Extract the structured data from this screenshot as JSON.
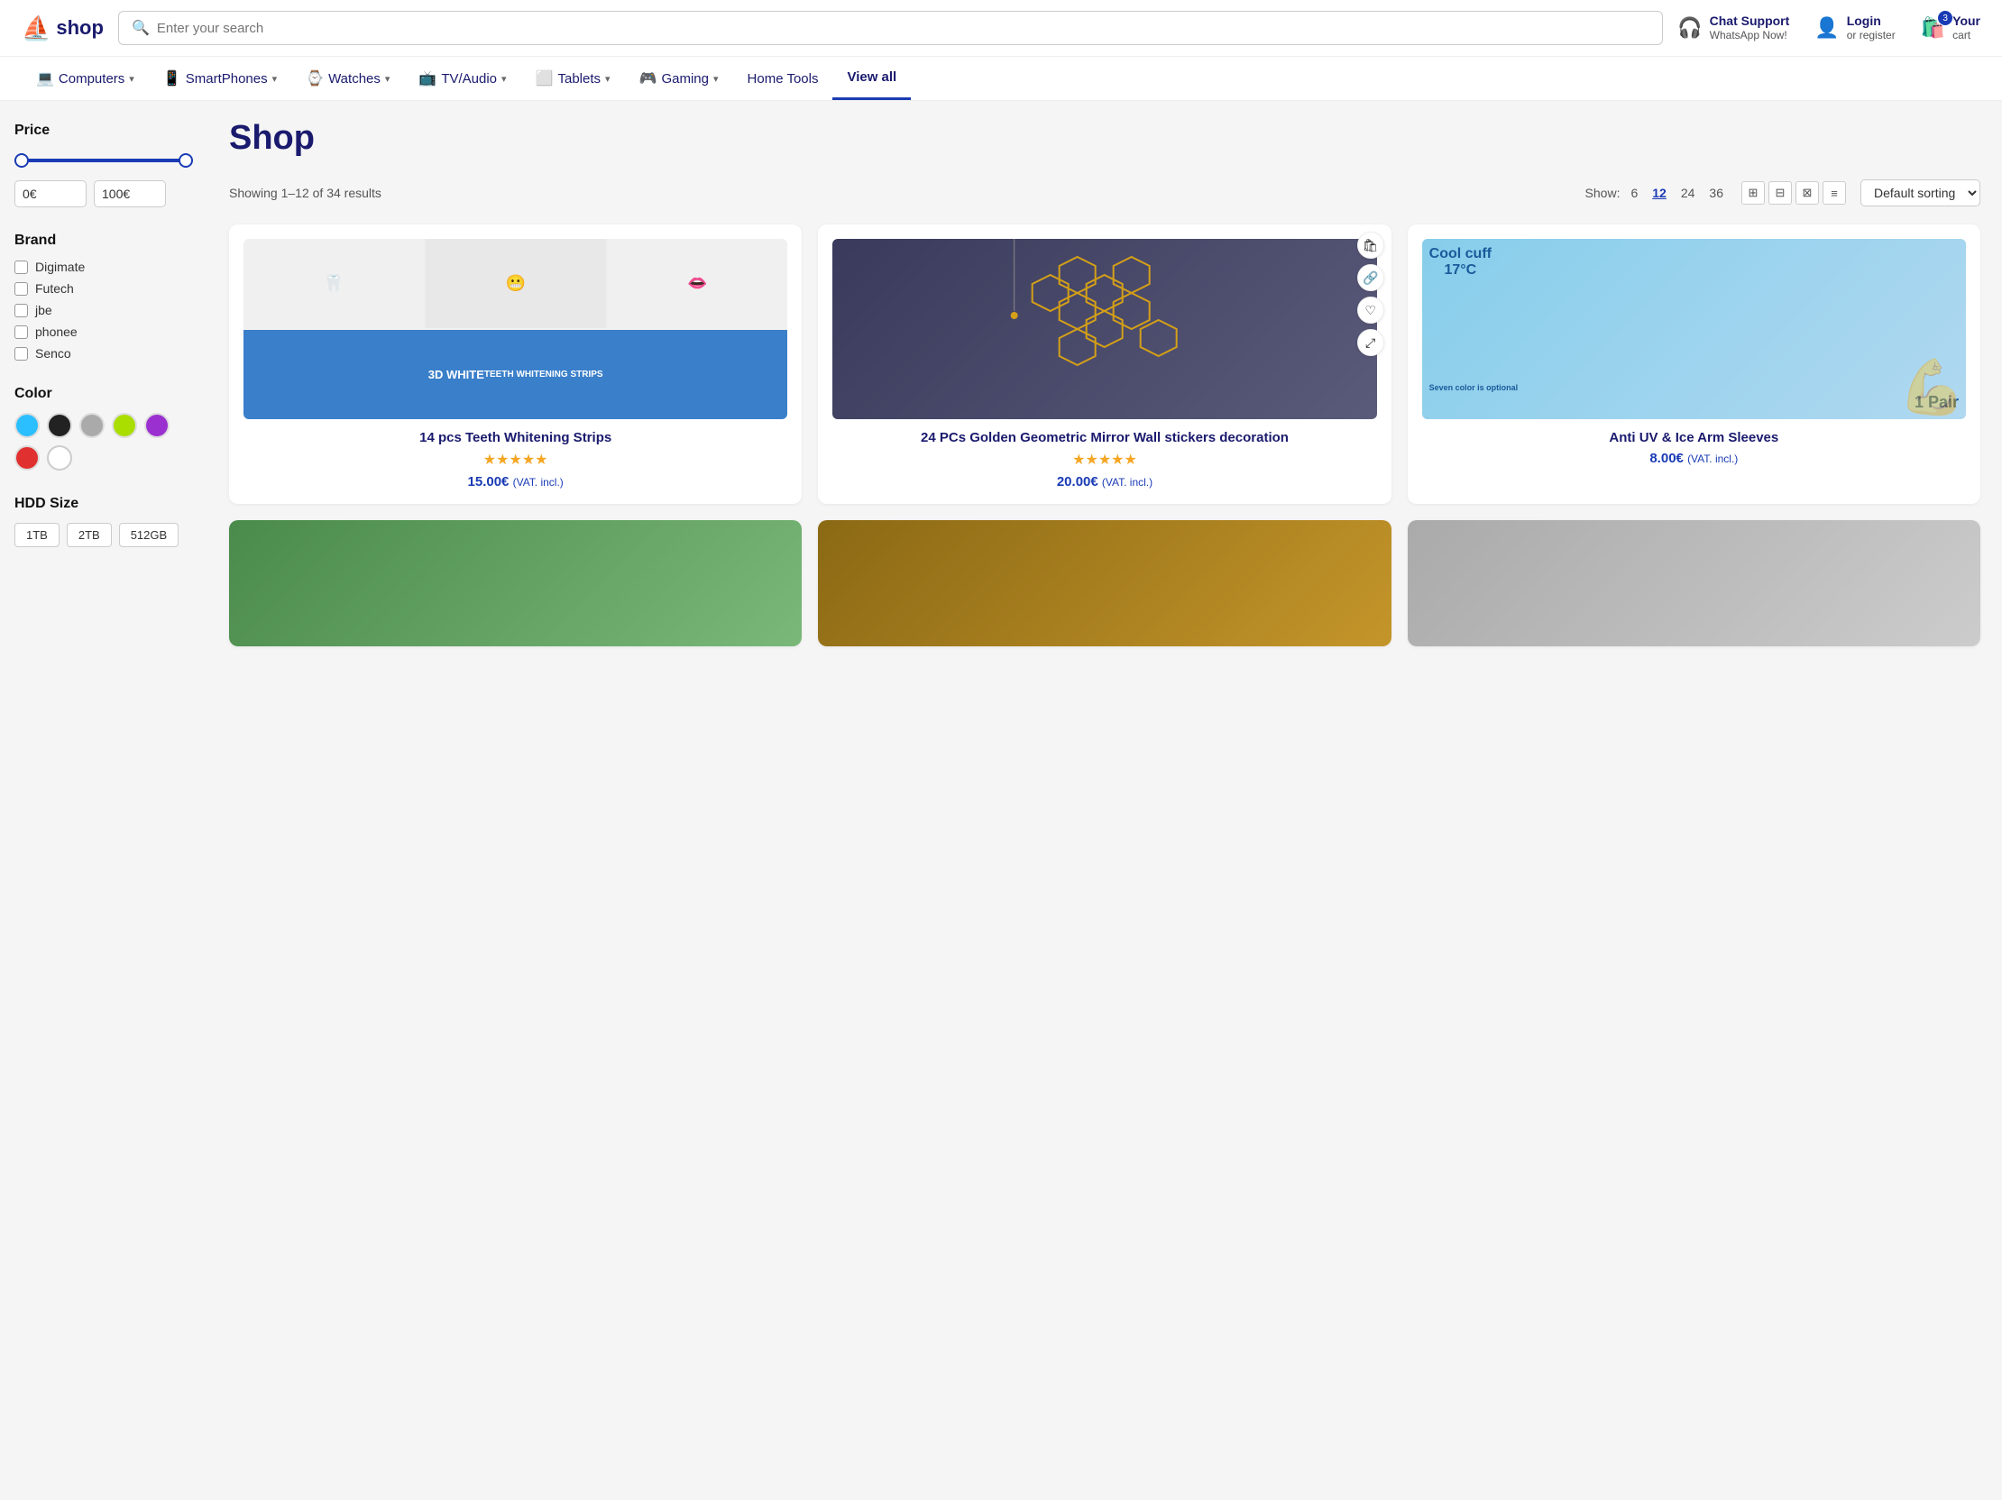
{
  "header": {
    "logo_text": "shop",
    "search_placeholder": "Enter your search",
    "chat_support_top": "Chat Support",
    "chat_support_bot": "WhatsApp Now!",
    "login_top": "Login",
    "login_bot": "or register",
    "cart_top": "Your",
    "cart_bot": "cart",
    "cart_count": "3"
  },
  "nav": {
    "items": [
      {
        "label": "Computers",
        "icon": "💻",
        "has_dropdown": true
      },
      {
        "label": "SmartPhones",
        "icon": "📱",
        "has_dropdown": true
      },
      {
        "label": "Watches",
        "icon": "⌚",
        "has_dropdown": true
      },
      {
        "label": "TV/Audio",
        "icon": "📺",
        "has_dropdown": true
      },
      {
        "label": "Tablets",
        "icon": "⬜",
        "has_dropdown": true
      },
      {
        "label": "Gaming",
        "icon": "🎮",
        "has_dropdown": true
      },
      {
        "label": "Home Tools",
        "icon": "",
        "has_dropdown": false
      },
      {
        "label": "View all",
        "icon": "",
        "has_dropdown": false,
        "active": true
      }
    ]
  },
  "sidebar": {
    "price_label": "Price",
    "price_min": "0€",
    "price_max": "100€",
    "brand_label": "Brand",
    "brands": [
      {
        "name": "Digimate"
      },
      {
        "name": "Futech"
      },
      {
        "name": "jbe"
      },
      {
        "name": "phonee"
      },
      {
        "name": "Senco"
      }
    ],
    "color_label": "Color",
    "colors": [
      {
        "hex": "#2bbfff",
        "name": "light-blue"
      },
      {
        "hex": "#222222",
        "name": "black"
      },
      {
        "hex": "#aaaaaa",
        "name": "gray"
      },
      {
        "hex": "#aadd00",
        "name": "lime"
      },
      {
        "hex": "#9b30d0",
        "name": "purple"
      },
      {
        "hex": "#e03030",
        "name": "red"
      },
      {
        "hex": "#ffffff",
        "name": "white"
      }
    ],
    "hdd_label": "HDD Size",
    "hdd_sizes": [
      "1TB",
      "2TB",
      "512GB"
    ]
  },
  "main": {
    "page_title": "Shop",
    "results_info": "Showing 1–12 of 34 results",
    "show_label": "Show:",
    "show_options": [
      "6",
      "12",
      "24",
      "36"
    ],
    "show_active": "12",
    "sorting_label": "Default sorting",
    "products": [
      {
        "id": 1,
        "name": "14 pcs Teeth Whitening Strips",
        "rating": 5,
        "price": "15.00€",
        "vat": "(VAT. incl.)",
        "type": "teeth"
      },
      {
        "id": 2,
        "name": "24 PCs Golden Geometric Mirror Wall stickers decoration",
        "rating": 5,
        "price": "20.00€",
        "vat": "(VAT. incl.)",
        "type": "gold-hex"
      },
      {
        "id": 3,
        "name": "Anti UV & Ice Arm Sleeves",
        "rating": 0,
        "price": "8.00€",
        "vat": "(VAT. incl.)",
        "type": "cool-cuff"
      }
    ],
    "bottom_products": [
      {
        "type": "green"
      },
      {
        "type": "brown"
      },
      {
        "type": "gray"
      }
    ]
  }
}
